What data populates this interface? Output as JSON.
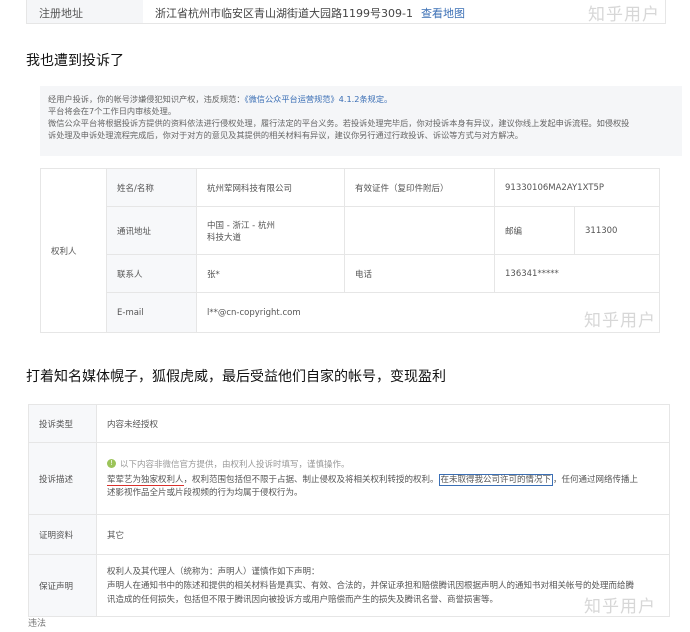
{
  "address_row": {
    "label": "注册地址",
    "value": "浙江省杭州市临安区青山湖街道大园路1199号309-1",
    "link": "查看地图"
  },
  "watermark": "知乎用户",
  "section1_text": "我也遭到投诉了",
  "notice": {
    "line1_prefix": "经用户投诉，你的帐号涉嫌侵犯知识产权，违反规范：",
    "line1_link": "《微信公众平台运营规范》4.1.2条规定。",
    "line2": "平台将会在7个工作日内审核处理。",
    "line3": "微信公众平台将根据投诉方提供的资料依法进行侵权处理，履行法定的平台义务。若投诉处理完毕后，你对投诉本身有异议，建议你线上发起申诉流程。如侵权投",
    "line4": "诉处理及申诉处理流程完成后，你对于对方的意见及其提供的相关材料有异议，建议你另行通过行政投诉、诉讼等方式与对方解决。"
  },
  "rights_holder": {
    "side_label": "权利人",
    "rows": [
      {
        "k1": "姓名/名称",
        "v1": "杭州荤网科技有限公司",
        "k2": "有效证件（复印件附后）",
        "v2": "91330106MA2AY1XT5P"
      },
      {
        "k1": "通讯地址",
        "v1a": "中国 - 浙江 - 杭州",
        "v1b": "科技大道",
        "k2": "邮编",
        "v2": "311300"
      },
      {
        "k1": "联系人",
        "v1": "张*",
        "k2": "电话",
        "v2": "136341*****"
      },
      {
        "k1": "E-mail",
        "v1": "l**@cn-copyright.com"
      }
    ]
  },
  "section2_text": "打着知名媒体幌子，狐假虎威，最后受益他们自家的帐号，变现盈利",
  "complaint": {
    "type_label": "投诉类型",
    "type_value": "内容未经授权",
    "desc_label": "投诉描述",
    "desc_info": "以下内容非微信官方提供，由权利人投诉时填写，谨慎操作。",
    "desc_p1": "荤荤艺为独家权利人",
    "desc_p2": "，权利范围包括但不限于占据、制止侵权及将相关权利转授的权利。",
    "desc_p3": "在未取得我公司许可的情况下",
    "desc_p4": "，任何通过网络传播上",
    "desc_p5": "述影视作品全片或片段视频的行为均属于侵权行为。",
    "evidence_label": "证明资料",
    "evidence_value": "其它",
    "guarantee_label": "保证声明",
    "guarantee_l1": "权利人及其代理人（统称为：声明人）谨慎作如下声明：",
    "guarantee_l2": "声明人在通知书中的陈述和提供的相关材料皆是真实、有效、合法的，并保证承担和赔偿腾讯因根据声明人的通知书对相关帐号的处理而给腾",
    "guarantee_l3": "讯造成的任何损失，包括但不限于腾讯因向被投诉方或用户赔偿而产生的损失及腾讯名誉、商誉损害等。"
  },
  "bottom_fragment": "违法"
}
